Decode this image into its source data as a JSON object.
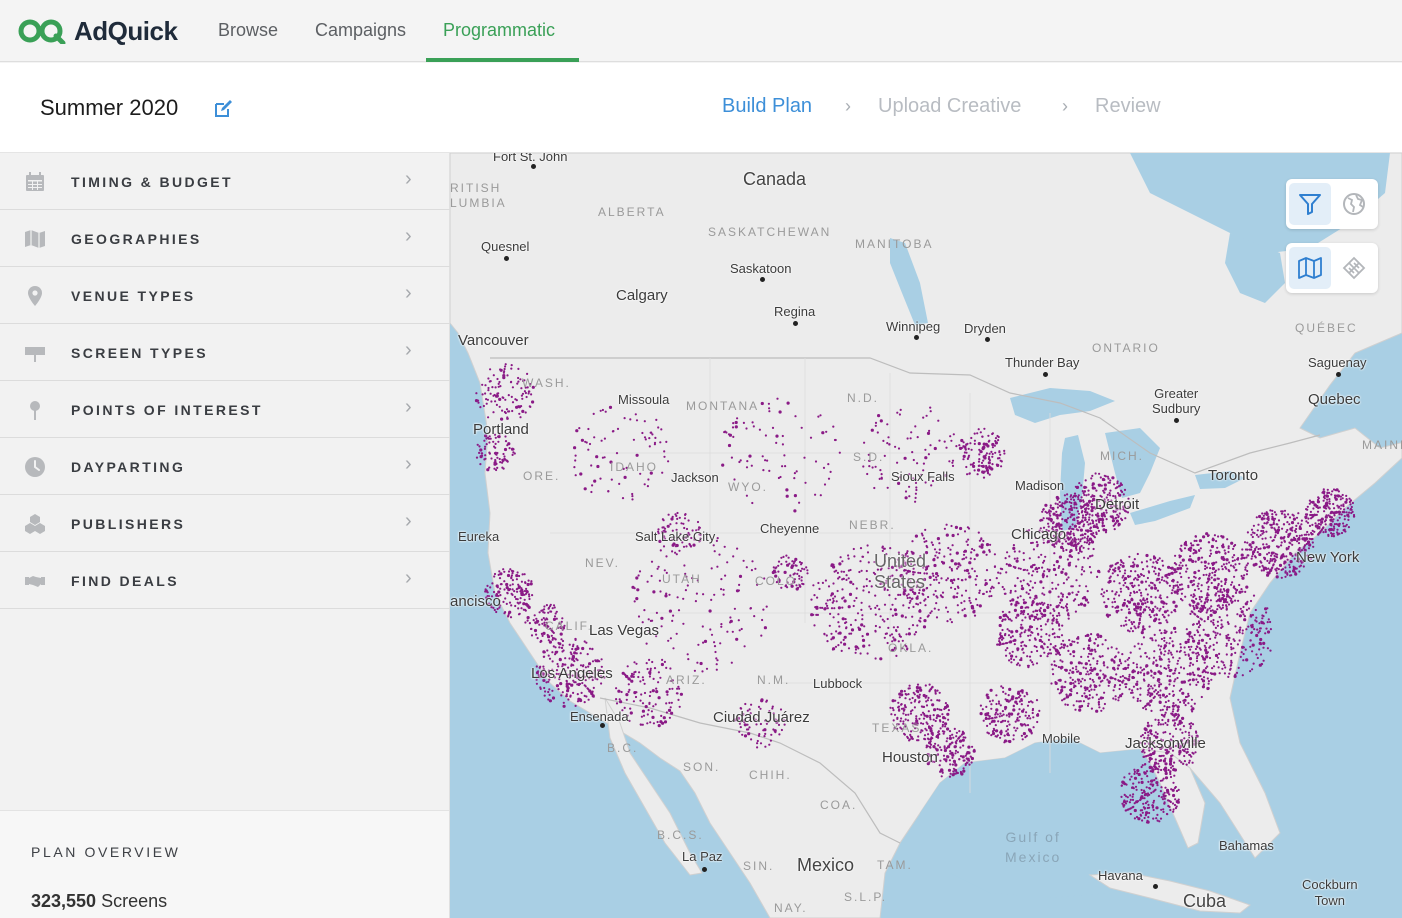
{
  "app": {
    "name": "AdQuick",
    "colors": {
      "accent": "#3aa057",
      "step_active": "#3d8fd8",
      "map_dots": "#8a1a86",
      "water": "#a9cfe4"
    }
  },
  "nav": {
    "links": [
      {
        "label": "Browse"
      },
      {
        "label": "Campaigns"
      },
      {
        "label": "Programmatic",
        "active": true
      }
    ]
  },
  "plan": {
    "title": "Summer 2020",
    "steps": [
      {
        "label": "Build Plan",
        "state": "active"
      },
      {
        "label": "Upload Creative",
        "state": "inactive"
      },
      {
        "label": "Review",
        "state": "inactive"
      }
    ]
  },
  "sidebar": {
    "items": [
      {
        "label": "TIMING & BUDGET",
        "icon": "calendar-icon"
      },
      {
        "label": "GEOGRAPHIES",
        "icon": "map-icon"
      },
      {
        "label": "VENUE TYPES",
        "icon": "location-pin-icon"
      },
      {
        "label": "SCREEN TYPES",
        "icon": "billboard-icon"
      },
      {
        "label": "POINTS OF INTEREST",
        "icon": "push-pin-icon"
      },
      {
        "label": "DAYPARTING",
        "icon": "clock-icon"
      },
      {
        "label": "PUBLISHERS",
        "icon": "cubes-icon"
      },
      {
        "label": "FIND DEALS",
        "icon": "handshake-icon"
      }
    ],
    "overview": {
      "title": "PLAN OVERVIEW",
      "count": "323,550",
      "count_unit": " Screens"
    }
  },
  "map": {
    "controls": {
      "filter_icon": "filter-icon",
      "globe_icon": "globe-icon",
      "map_icon": "map-view-icon",
      "satellite_icon": "satellite-icon"
    },
    "labels": {
      "fort_st_john": "Fort St. John",
      "british_columbia": "RITISH\nLUMBIA",
      "canada": "Canada",
      "alberta": "ALBERTA",
      "saskatchewan": "SASKATCHEWAN",
      "manitoba": "MANITOBA",
      "quebec_region": "QUÉBEC",
      "ontario": "ONTARIO",
      "maine": "MAINE",
      "quesnel": "Quesnel",
      "saskatoon": "Saskatoon",
      "calgary": "Calgary",
      "regina": "Regina",
      "winnipeg": "Winnipeg",
      "dryden": "Dryden",
      "vancouver": "Vancouver",
      "thunder_bay": "Thunder Bay",
      "saguenay": "Saguenay",
      "quebec_city": "Quebec",
      "greater_sudbury": "Greater\nSudbury",
      "wash": "WASH.",
      "missoula": "Missoula",
      "montana": "MONTANA",
      "nd": "N.D.",
      "portland": "Portland",
      "idaho": "IDAHO",
      "ore": "ORE.",
      "sd": "S.D.",
      "jackson": "Jackson",
      "wyo": "WYO.",
      "sioux_falls": "Sioux Falls",
      "madison": "Madison",
      "toronto": "Toronto",
      "mich": "MICH.",
      "detroit": "Detroit",
      "eureka": "Eureka",
      "cheyenne": "Cheyenne",
      "nebr": "NEBR.",
      "salt_lake_city": "Salt Lake City",
      "chicago": "Chicago",
      "new_york": "New York",
      "nev": "NEV.",
      "united_states": "United\nStates",
      "utah": "UTAH",
      "colo": "COLO.",
      "san_francisco": "ancisco",
      "calif": "CALIF.",
      "las_vegas": "Las Vegas",
      "okla": "OKLA.",
      "los_angeles": "Los Angeles",
      "ariz": "ARIZ.",
      "nm": "N.M.",
      "lubbock": "Lubbock",
      "ensenada": "Ensenada",
      "ciudad_juarez": "Ciudad Juárez",
      "texas": "TEXAS",
      "bc": "B.C.",
      "mobile": "Mobile",
      "jacksonville": "Jacksonville",
      "son": "SON.",
      "chih": "CHIH.",
      "houston": "Houston",
      "coa": "COA.",
      "gulf_of_mexico": "Gulf of\nMexico",
      "bcs": "B.C.S.",
      "bahamas": "Bahamas",
      "la_paz": "La Paz",
      "sin": "SIN.",
      "mexico": "Mexico",
      "tam": "TAM.",
      "havana": "Havana",
      "cockburn_town": "Cockburn\nTown",
      "cuba": "Cuba",
      "slp": "S.L.P.",
      "nay": "NAY."
    }
  }
}
